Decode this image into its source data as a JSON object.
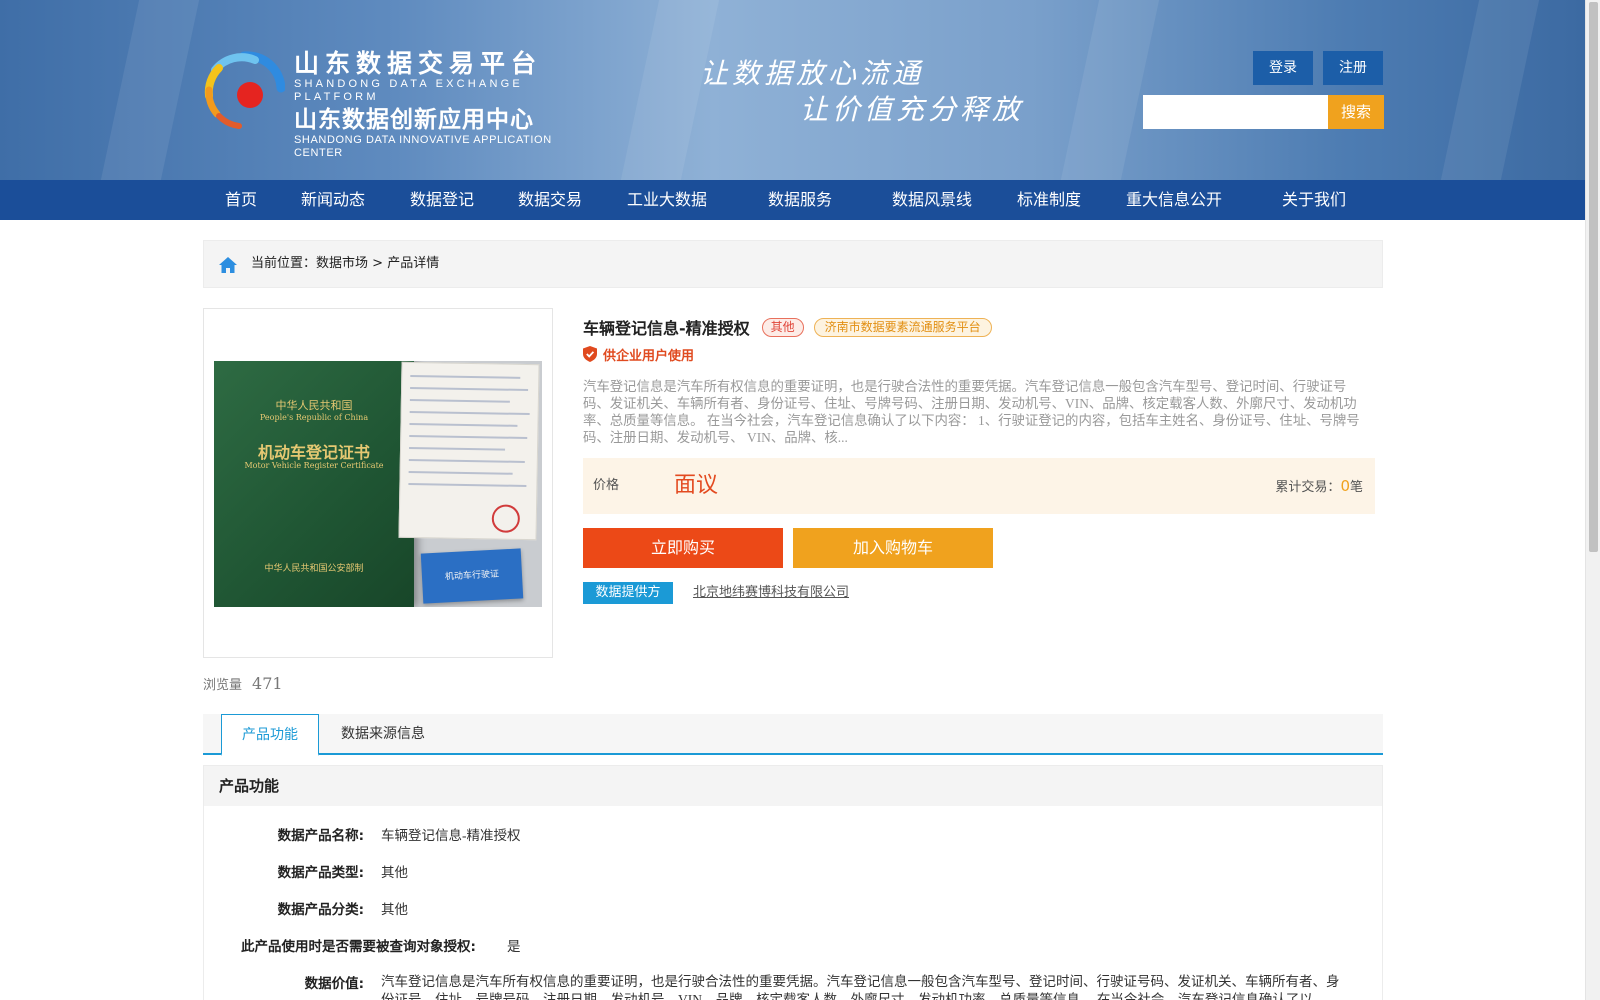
{
  "header": {
    "logo_cn_line1": "山东数据交易平台",
    "logo_en_line1": "SHANDONG DATA EXCHANGE PLATFORM",
    "logo_cn_line2": "山东数据创新应用中心",
    "logo_en_line2": "SHANDONG DATA INNOVATIVE APPLICATION CENTER",
    "slogan_line1": "让数据放心流通",
    "slogan_line2": "让价值充分释放",
    "login_label": "登录",
    "register_label": "注册",
    "search_placeholder": "",
    "search_label": "搜索"
  },
  "nav": {
    "items": [
      "首页",
      "新闻动态",
      "数据登记",
      "数据交易",
      "工业大数据",
      "数据服务",
      "数据风景线",
      "标准制度",
      "重大信息公开",
      "关于我们"
    ]
  },
  "breadcrumb": {
    "prefix": "当前位置：",
    "market": "数据市场",
    "separator": " > ",
    "current": "产品详情"
  },
  "product": {
    "image_caption_cn1": "中华人民共和国",
    "image_caption_en1": "People's Republic of China",
    "image_caption_cn2": "机动车登记证书",
    "image_caption_en2": "Motor Vehicle Register Certificate",
    "image_caption_cn3": "中华人民共和国公安部制",
    "image_card_text": "机动车行驶证",
    "title": "车辆登记信息-精准授权",
    "tag_type": "其他",
    "tag_platform": "济南市数据要素流通服务平台",
    "audience": "供企业用户使用",
    "description": "汽车登记信息是汽车所有权信息的重要证明，也是行驶合法性的重要凭据。汽车登记信息一般包含汽车型号、登记时间、行驶证号码、发证机关、车辆所有者、身份证号、住址、号牌号码、注册日期、发动机号、VIN、品牌、核定载客人数、外廓尺寸、发动机功率、总质量等信息。 在当今社会，汽车登记信息确认了以下内容： 1、行驶证登记的内容，包括车主姓名、身份证号、住址、号牌号码、注册日期、发动机号、 VIN、品牌、核...",
    "price_label": "价格",
    "price_value": "面议",
    "trade_label": "累计交易：",
    "trade_count": "0",
    "trade_unit": "笔",
    "buy_label": "立即购买",
    "cart_label": "加入购物车",
    "provider_label": "数据提供方",
    "provider_name": "北京地纬赛博科技有限公司",
    "views_label": "浏览量",
    "views_count": "471"
  },
  "tabs": [
    {
      "label": "产品功能"
    },
    {
      "label": "数据来源信息"
    }
  ],
  "detail": {
    "section_title": "产品功能",
    "fields": [
      {
        "label": "数据产品名称:",
        "value": "车辆登记信息-精准授权"
      },
      {
        "label": "数据产品类型:",
        "value": "其他"
      },
      {
        "label": "数据产品分类:",
        "value": "其他"
      },
      {
        "label": "此产品使用时是否需要被查询对象授权:",
        "value": "是"
      },
      {
        "label": "数据价值:",
        "value": "汽车登记信息是汽车所有权信息的重要证明，也是行驶合法性的重要凭据。汽车登记信息一般包含汽车型号、登记时间、行驶证号码、发证机关、车辆所有者、身份证号、住址、号牌号码、注册日期、发动机号、VIN、品牌、核定载客人数、外廓尺寸、发动机功率、总质量等信息。 在当今社会，汽车登记信息确认了以"
      }
    ]
  },
  "colors": {
    "nav_bg": "#1b4e99",
    "accent_orange": "#f0a21e",
    "buy_red": "#ec4917",
    "tab_blue": "#1b9ad6"
  }
}
